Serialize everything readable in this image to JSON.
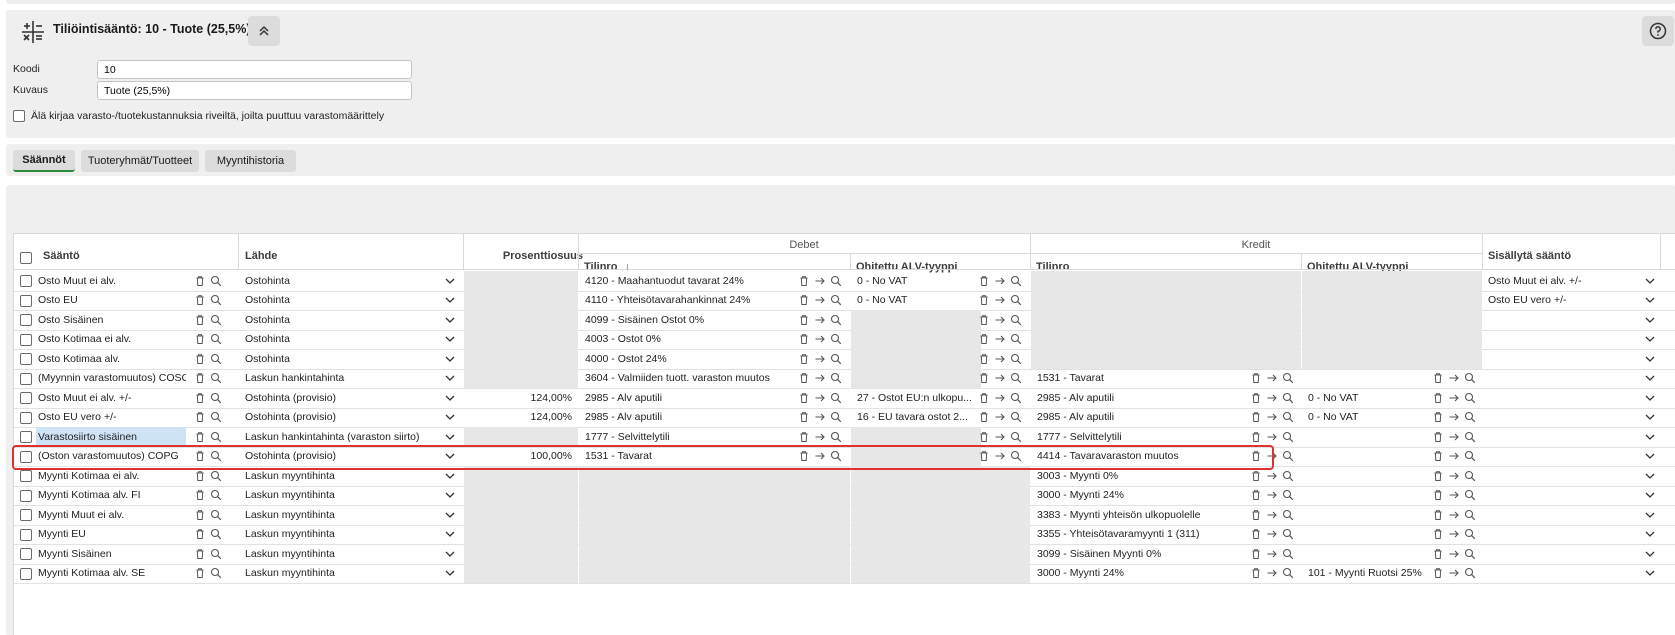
{
  "panel": {
    "title": "Tiliöintisääntö: 10 - Tuote (25,5%)",
    "koodi_label": "Koodi",
    "koodi_value": "10",
    "kuvaus_label": "Kuvaus",
    "kuvaus_value": "Tuote (25,5%)",
    "option_label": "Älä kirjaa varasto-/tuotekustannuksia riveiltä, joilta puuttuu varastomäärittely"
  },
  "tabs": [
    {
      "label": "Säännöt",
      "active": true
    },
    {
      "label": "Tuoteryhmät/Tuotteet",
      "active": false
    },
    {
      "label": "Myyntihistoria",
      "active": false
    }
  ],
  "grid": {
    "group_debet": "Debet",
    "group_kredit": "Kredit",
    "col_saanto": "Sääntö",
    "col_lahde": "Lähde",
    "col_prosentti": "Prosenttiosuus",
    "col_tilinro": "Tilinro",
    "col_ohitettu": "Ohitettu ALV-tyyppi",
    "col_kredit_tilinro": "Tilinro",
    "col_kredit_ohitettu": "Ohitettu ALV-tyyppi",
    "col_sisallyta": "Sisällytä sääntö",
    "sort_arrow": "↓",
    "rows": [
      {
        "saanto": "Osto Muut ei alv.",
        "lahde": "Ostohinta",
        "prosentti": "",
        "d_tilinro": "4120 - Maahantuodut tavarat 24%",
        "d_alv": "0 - No VAT",
        "k_tilinro": "",
        "k_alv": "",
        "sisallyta": "Osto Muut ei alv. +/-"
      },
      {
        "saanto": "Osto EU",
        "lahde": "Ostohinta",
        "prosentti": "",
        "d_tilinro": "4110 - Yhteisötavarahankinnat 24%",
        "d_alv": "0 - No VAT",
        "k_tilinro": "",
        "k_alv": "",
        "sisallyta": "Osto EU vero +/-"
      },
      {
        "saanto": "Osto Sisäinen",
        "lahde": "Ostohinta",
        "prosentti": "",
        "d_tilinro": "4099 - Sisäinen Ostot 0%",
        "d_alv": "",
        "k_tilinro": "",
        "k_alv": "",
        "sisallyta": ""
      },
      {
        "saanto": "Osto Kotimaa ei alv.",
        "lahde": "Ostohinta",
        "prosentti": "",
        "d_tilinro": "4003 - Ostot 0%",
        "d_alv": "",
        "k_tilinro": "",
        "k_alv": "",
        "sisallyta": ""
      },
      {
        "saanto": "Osto Kotimaa alv.",
        "lahde": "Ostohinta",
        "prosentti": "",
        "d_tilinro": "4000 - Ostot 24%",
        "d_alv": "",
        "k_tilinro": "",
        "k_alv": "",
        "sisallyta": ""
      },
      {
        "saanto": "(Myynnin varastomuutos) COSG",
        "lahde": "Laskun hankintahinta",
        "prosentti": "",
        "d_tilinro": "3604 - Valmiiden tuott. varaston muutos",
        "d_alv": "",
        "k_tilinro": "1531 - Tavarat",
        "k_alv": "",
        "sisallyta": ""
      },
      {
        "saanto": "Osto Muut ei alv. +/-",
        "lahde": "Ostohinta (provisio)",
        "prosentti": "124,00%",
        "d_tilinro": "2985 - Alv aputili",
        "d_alv": "27 - Ostot EU:n ulkopu...",
        "k_tilinro": "2985 - Alv aputili",
        "k_alv": "0 - No VAT",
        "sisallyta": ""
      },
      {
        "saanto": "Osto EU vero +/-",
        "lahde": "Ostohinta (provisio)",
        "prosentti": "124,00%",
        "d_tilinro": "2985 - Alv aputili",
        "d_alv": "16 - EU tavara ostot 2...",
        "k_tilinro": "2985 - Alv aputili",
        "k_alv": "0 - No VAT",
        "sisallyta": ""
      },
      {
        "saanto": "Varastosiirto sisäinen",
        "lahde": "Laskun hankintahinta (varaston siirto)",
        "prosentti": "",
        "d_tilinro": "1777 - Selvittelytili",
        "d_alv": "",
        "k_tilinro": "1777 - Selvittelytili",
        "k_alv": "",
        "sisallyta": ""
      },
      {
        "saanto": "(Oston varastomuutos) COPG",
        "lahde": "Ostohinta (provisio)",
        "prosentti": "100,00%",
        "d_tilinro": "1531 - Tavarat",
        "d_alv": "",
        "k_tilinro": "4414 - Tavaravaraston muutos",
        "k_alv": "",
        "sisallyta": ""
      },
      {
        "saanto": "Myynti Kotimaa ei alv.",
        "lahde": "Laskun myyntihinta",
        "prosentti": "",
        "d_tilinro": "",
        "d_alv": "",
        "k_tilinro": "3003 - Myynti 0%",
        "k_alv": "",
        "sisallyta": ""
      },
      {
        "saanto": "Myynti Kotimaa alv. FI",
        "lahde": "Laskun myyntihinta",
        "prosentti": "",
        "d_tilinro": "",
        "d_alv": "",
        "k_tilinro": "3000 - Myynti 24%",
        "k_alv": "",
        "sisallyta": ""
      },
      {
        "saanto": "Myynti Muut ei alv.",
        "lahde": "Laskun myyntihinta",
        "prosentti": "",
        "d_tilinro": "",
        "d_alv": "",
        "k_tilinro": "3383 - Myynti yhteisön ulkopuolelle",
        "k_alv": "",
        "sisallyta": ""
      },
      {
        "saanto": "Myynti EU",
        "lahde": "Laskun myyntihinta",
        "prosentti": "",
        "d_tilinro": "",
        "d_alv": "",
        "k_tilinro": "3355 - Yhteisötavaramyynti 1 (311)",
        "k_alv": "",
        "sisallyta": ""
      },
      {
        "saanto": "Myynti Sisäinen",
        "lahde": "Laskun myyntihinta",
        "prosentti": "",
        "d_tilinro": "",
        "d_alv": "",
        "k_tilinro": "3099 - Sisäinen Myynti 0%",
        "k_alv": "",
        "sisallyta": ""
      },
      {
        "saanto": "Myynti Kotimaa alv. SE",
        "lahde": "Laskun myyntihinta",
        "prosentti": "",
        "d_tilinro": "",
        "d_alv": "",
        "k_tilinro": "3000 - Myynti 24%",
        "k_alv": "101 - Myynti Ruotsi 25%",
        "sisallyta": ""
      }
    ]
  }
}
